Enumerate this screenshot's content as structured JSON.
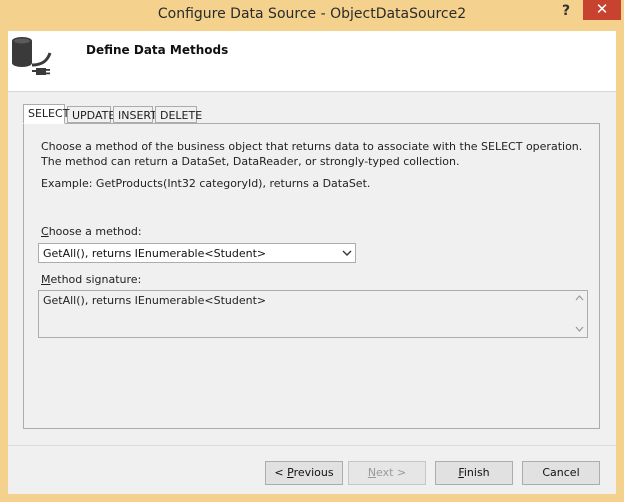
{
  "window": {
    "title": "Configure Data Source - ObjectDataSource2",
    "help_label": "?",
    "close_label": "✕"
  },
  "header": {
    "title": "Define Data Methods",
    "icon": "database-plug-icon"
  },
  "tabs": [
    {
      "label": "SELECT",
      "active": true
    },
    {
      "label": "UPDATE",
      "active": false
    },
    {
      "label": "INSERT",
      "active": false
    },
    {
      "label": "DELETE",
      "active": false
    }
  ],
  "panel": {
    "description": "Choose a method of the business object that returns data to associate with the SELECT operation. The method can return a DataSet, DataReader, or strongly-typed collection.",
    "example": "Example: GetProducts(Int32 categoryId), returns a DataSet.",
    "choose_label": "Choose a method:",
    "choose_accel": "C",
    "choose_rest": "hoose a method:",
    "method_selected": "GetAll(), returns IEnumerable<Student>",
    "signature_label": "Method signature:",
    "signature_accel": "M",
    "signature_rest": "ethod signature:",
    "signature_value": "GetAll(), returns IEnumerable<Student>"
  },
  "buttons": {
    "previous": {
      "label": "< Previous",
      "pre": "< ",
      "accel": "P",
      "rest": "revious",
      "enabled": true
    },
    "next": {
      "label": "Next >",
      "pre": "",
      "accel": "N",
      "rest": "ext >",
      "enabled": false
    },
    "finish": {
      "label": "Finish",
      "pre": "",
      "accel": "F",
      "rest": "inish",
      "enabled": true
    },
    "cancel": {
      "label": "Cancel",
      "enabled": true
    }
  },
  "colors": {
    "frame": "#f4d28d",
    "close": "#c7432f",
    "client": "#f0f0f0"
  }
}
